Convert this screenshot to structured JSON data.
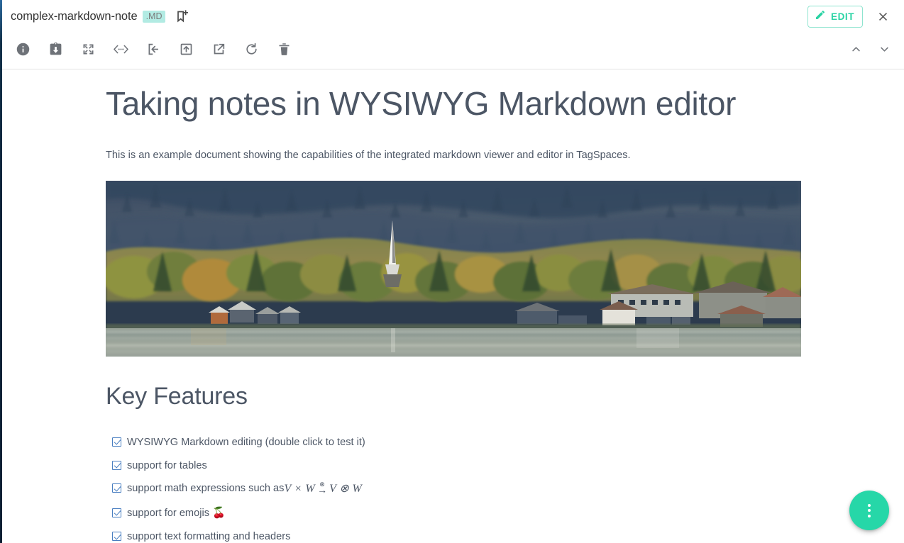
{
  "header": {
    "file_name": "complex-markdown-note",
    "file_extension_badge": ".MD",
    "add_tag_icon": "bookmark-add-icon",
    "edit_label": "EDIT",
    "edit_icon": "pencil-icon",
    "close_icon": "close-icon",
    "accent_color": "#2ad3a4",
    "badge_bg_color": "#b2ebe3"
  },
  "toolbar": {
    "items": [
      {
        "name": "properties-button",
        "icon": "info-icon",
        "title": "Properties"
      },
      {
        "name": "save-button",
        "icon": "save-clipboard-icon",
        "title": "Save"
      },
      {
        "name": "fullscreen-button",
        "icon": "fullscreen-icon",
        "title": "Open in fullscreen"
      },
      {
        "name": "source-view-button",
        "icon": "code-chevrons-icon",
        "title": "Source code"
      },
      {
        "name": "open-natively-button",
        "icon": "arrow-into-box-icon",
        "title": "Open natively"
      },
      {
        "name": "open-containing-folder-button",
        "icon": "arrow-up-box-icon",
        "title": "Open containing folder"
      },
      {
        "name": "open-external-button",
        "icon": "external-link-icon",
        "title": "Open in new window"
      },
      {
        "name": "reload-button",
        "icon": "refresh-icon",
        "title": "Reload"
      },
      {
        "name": "delete-button",
        "icon": "trash-icon",
        "title": "Delete"
      }
    ],
    "nav_prev": {
      "name": "previous-file-button",
      "icon": "chevron-up-icon"
    },
    "nav_next": {
      "name": "next-file-button",
      "icon": "chevron-down-icon"
    }
  },
  "document": {
    "title": "Taking notes in WYSIWYG Markdown editor",
    "intro": "This is an example document showing the capabilities of the integrated markdown viewer and editor in TagSpaces.",
    "image_alt": "Lakeside alpine village with autumn forest and church spire reflected in calm water",
    "section_heading": "Key Features",
    "features": [
      {
        "checked": true,
        "text": "WYSIWYG Markdown editing (double click to test it)",
        "math": null,
        "emoji": null
      },
      {
        "checked": true,
        "text": "support for tables",
        "math": null,
        "emoji": null
      },
      {
        "checked": true,
        "text": "support math expressions such as",
        "math": {
          "lhs": "V × W",
          "arrow_superscript": "⊗",
          "arrow": "→",
          "rhs": "V ⊗ W"
        },
        "emoji": null
      },
      {
        "checked": true,
        "text": "support for emojis",
        "math": null,
        "emoji": "🍒"
      },
      {
        "checked": true,
        "text": "support text formatting and headers",
        "math": null,
        "emoji": null
      }
    ]
  },
  "fab": {
    "name": "more-actions-button",
    "icon": "more-vertical-icon",
    "color": "#26d7a8"
  }
}
